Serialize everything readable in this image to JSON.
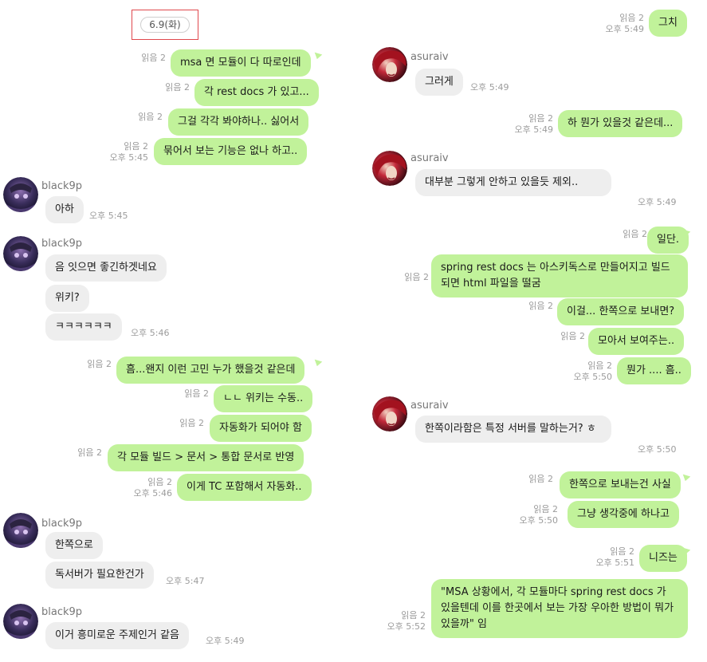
{
  "date_label": "6.9(화)",
  "left": {
    "sent_1": {
      "read": "읽음 2",
      "text": "msa 면 모듈이 다 따로인데"
    },
    "sent_2": {
      "read": "읽음 2",
      "text": "각 rest docs 가 있고..."
    },
    "sent_3": {
      "read": "읽음 2",
      "text": "그걸 각각 봐야하나.. 싫어서"
    },
    "sent_4": {
      "read": "읽음 2",
      "time": "오후 5:45",
      "text": "묶어서 보는 기능은 없나 하고.."
    },
    "group_1": {
      "name": "black9p",
      "msg": "아하",
      "time": "오후 5:45"
    },
    "group_2": {
      "name": "black9p",
      "msg1": "음 잇으면 좋긴하겟네요",
      "msg2": "위키?",
      "msg3": "ㅋㅋㅋㅋㅋㅋ",
      "time": "오후 5:46"
    },
    "sent_5": {
      "read": "읽음 2",
      "text": "흠...왠지 이런 고민 누가 했을것 같은데"
    },
    "sent_6": {
      "read": "읽음 2",
      "text": "ㄴㄴ 위키는 수동.."
    },
    "sent_7": {
      "read": "읽음 2",
      "text": "자동화가 되어야 함"
    },
    "sent_8": {
      "read": "읽음 2",
      "text": "각 모듈 빌드 > 문서 > 통합 문서로 반영"
    },
    "sent_9": {
      "read": "읽음 2",
      "time": "오후 5:46",
      "text": "이게 TC 포함해서 자동화.."
    },
    "group_3": {
      "name": "black9p",
      "msg1": "한쪽으로",
      "msg2": "독서버가 필요한건가",
      "time": "오후 5:47"
    },
    "group_4": {
      "name": "black9p",
      "msg": "이거 흥미로운 주제인거 같음",
      "time": "오후 5:49"
    }
  },
  "right": {
    "sent_1": {
      "read": "읽음 2",
      "time": "오후 5:49",
      "text": "그치"
    },
    "group_1": {
      "name": "asuraiv",
      "msg": "그러게",
      "time": "오후 5:49"
    },
    "sent_2": {
      "read": "읽음 2",
      "time": "오후 5:49",
      "text": "하 뭔가 있을것 같은데..."
    },
    "group_2": {
      "name": "asuraiv",
      "msg": "대부분 그렇게 안하고 있을듯          제외..",
      "time": "오후 5:49"
    },
    "sent_3": {
      "read": "읽음 2",
      "text": "일단."
    },
    "sent_4": {
      "read": "읽음 2",
      "text": "spring rest docs 는 아스키독스로 만들어지고 빌드되면 html 파일을 떨굼"
    },
    "sent_5": {
      "read": "읽음 2",
      "text": "이걸... 한쪽으로 보내면?"
    },
    "sent_6": {
      "read": "읽음 2",
      "text": "모아서 보여주는.."
    },
    "sent_7": {
      "read": "읽음 2",
      "time": "오후 5:50",
      "text": "뭔가 .... 흠.."
    },
    "group_3": {
      "name": "asuraiv",
      "msg": "한쪽이라함은 특정 서버를 말하는거? ㅎ",
      "time": "오후 5:50"
    },
    "sent_8": {
      "read": "읽음 2",
      "text": "한쪽으로 보내는건 사실"
    },
    "sent_9": {
      "read": "읽음 2",
      "time": "오후 5:50",
      "text": "그냥 생각중에 하나고"
    },
    "sent_10": {
      "read": "읽음 2",
      "time": "오후 5:51",
      "text": "니즈는"
    },
    "sent_11": {
      "read": "읽음 2",
      "time": "오후 5:52",
      "text": "\"MSA 상황에서, 각 모듈마다 spring rest docs 가 있을텐데 이를 한곳에서 보는 가장 우아한 방법이 뭐가 있을까\" 임"
    }
  },
  "colors": {
    "my_bubble": "#c1f29a",
    "other_bubble": "#eeeeee",
    "meta_text": "#9c9c9c",
    "highlight_box": "#e0484d"
  },
  "icons": {
    "black9p_avatar": "avatar-black9p-icon",
    "asuraiv_avatar": "avatar-asuraiv-icon"
  }
}
